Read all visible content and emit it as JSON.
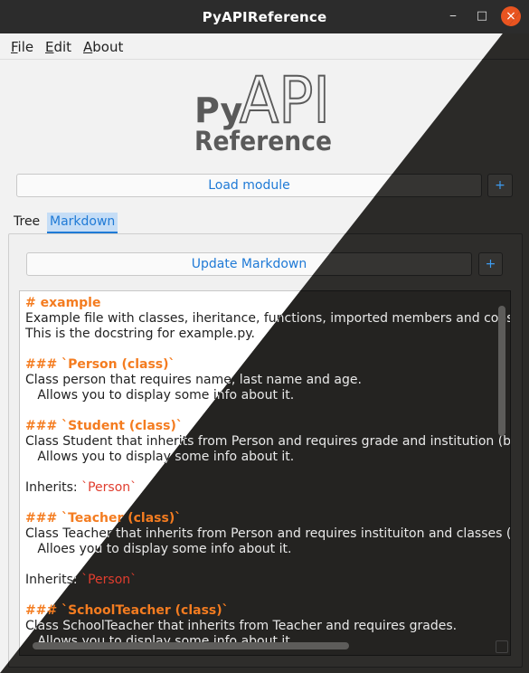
{
  "window": {
    "title": "PyAPIReference",
    "minimize_glyph": "⎯",
    "maximize_glyph": "□",
    "close_glyph": "×"
  },
  "menu": {
    "file": "File",
    "edit": "Edit",
    "about": "About"
  },
  "logo": {
    "py": "Py",
    "api": "API",
    "reference": "Reference"
  },
  "toolbar": {
    "load_module": "Load module",
    "plus": "+"
  },
  "tabs": {
    "tree": "Tree",
    "markdown": "Markdown"
  },
  "markdown_panel": {
    "update_label": "Update Markdown",
    "plus": "+",
    "lines": [
      {
        "text": "# example",
        "style": "h"
      },
      {
        "text": "Example file with classes, iheritance, functions, imported members and constants to test PyAPIReference.",
        "style": ""
      },
      {
        "text": "This is the docstring for example.py.",
        "style": ""
      },
      {
        "text": "",
        "style": ""
      },
      {
        "text": "### `Person (class)`",
        "style": "h"
      },
      {
        "text": "Class person that requires name, last name and age.",
        "style": ""
      },
      {
        "text": "   Allows you to display some info about it.",
        "style": ""
      },
      {
        "text": "",
        "style": ""
      },
      {
        "text": "### `Student (class)`",
        "style": "h"
      },
      {
        "text": "Class Student that inherits from Person and requires grade and institution (besides Person's requirements).",
        "style": ""
      },
      {
        "text": "   Allows you to display some info about it.",
        "style": ""
      },
      {
        "text": "",
        "style": ""
      },
      {
        "text": "Inherits: ",
        "style": "inherit",
        "code": "`Person`"
      },
      {
        "text": "",
        "style": ""
      },
      {
        "text": "### `Teacher (class)`",
        "style": "h"
      },
      {
        "text": "Class Teacher that inherits from Person and requires instituiton and classes (besides Person's requirements).",
        "style": ""
      },
      {
        "text": "   Alloes you to display some info about it.",
        "style": ""
      },
      {
        "text": "",
        "style": ""
      },
      {
        "text": "Inherits: ",
        "style": "inherit",
        "code": "`Person`"
      },
      {
        "text": "",
        "style": ""
      },
      {
        "text": "### `SchoolTeacher (class)`",
        "style": "h"
      },
      {
        "text": "Class SchoolTeacher that inherits from Teacher and requires grades.",
        "style": ""
      },
      {
        "text": "   Allows you to display some info about it.",
        "style": ""
      }
    ]
  },
  "colors": {
    "accent": "#1f7ad6",
    "heading": "#f47c20",
    "code": "#e03d2e",
    "logo_gray": "#5a5a5a",
    "dark_bg": "#2b2a28"
  }
}
